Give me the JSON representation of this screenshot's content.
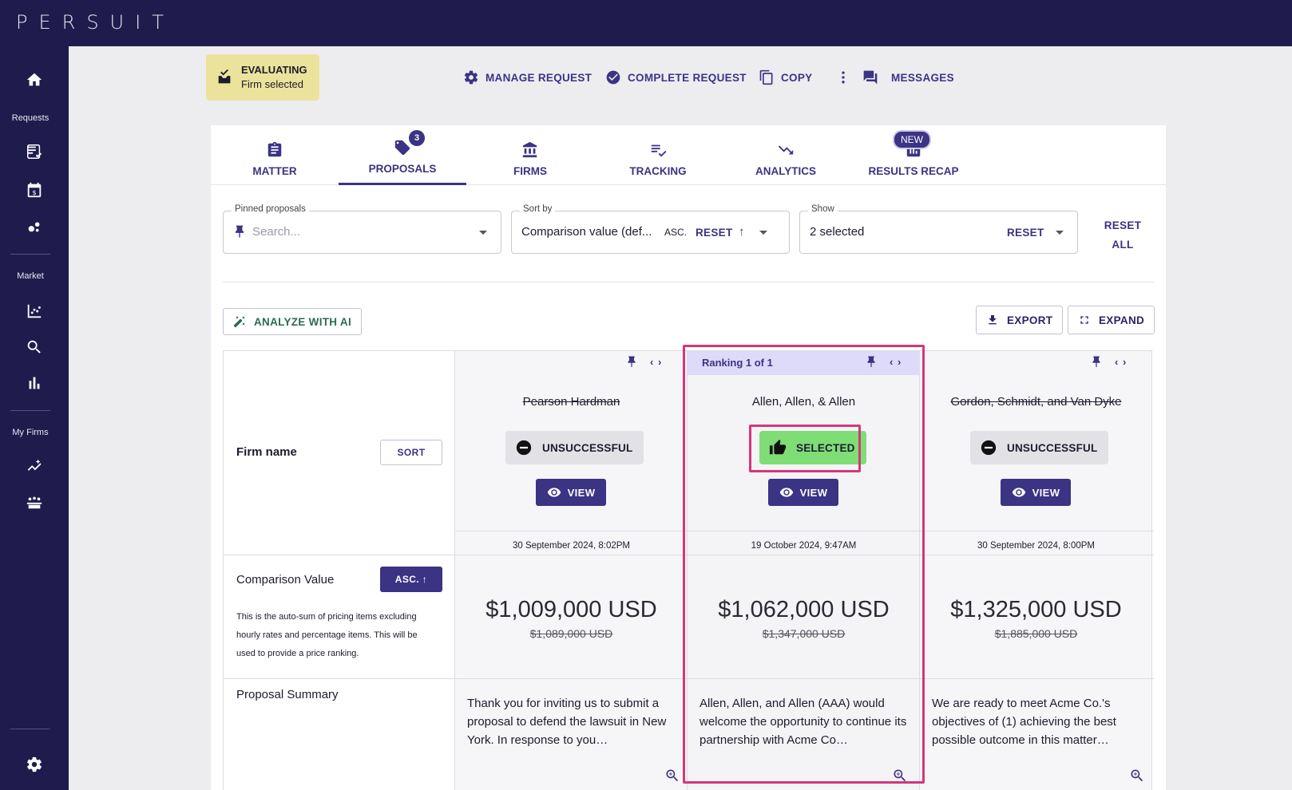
{
  "app": {
    "logo": "PERSUIT"
  },
  "rail": {
    "sections": [
      "Requests",
      "Market",
      "My Firms"
    ]
  },
  "status": {
    "title": "EVALUATING",
    "subtitle": "Firm selected"
  },
  "actions": {
    "manage": "MANAGE REQUEST",
    "complete": "COMPLETE REQUEST",
    "copy": "COPY",
    "messages": "MESSAGES"
  },
  "tabs": [
    {
      "label": "MATTER"
    },
    {
      "label": "PROPOSALS",
      "count": "3"
    },
    {
      "label": "FIRMS"
    },
    {
      "label": "TRACKING"
    },
    {
      "label": "ANALYTICS"
    },
    {
      "label": "RESULTS RECAP",
      "badge": "NEW"
    }
  ],
  "filters": {
    "pinned": {
      "label": "Pinned proposals",
      "placeholder": "Search..."
    },
    "sort": {
      "label": "Sort by",
      "value": "Comparison value (def...",
      "order": "ASC.",
      "reset": "RESET"
    },
    "show": {
      "label": "Show",
      "value": "2 selected",
      "reset": "RESET"
    },
    "reset_all_1": "RESET",
    "reset_all_2": "ALL"
  },
  "toolbar": {
    "analyze": "ANALYZE WITH AI",
    "export": "EXPORT",
    "expand": "EXPAND"
  },
  "rows": {
    "firm_name": "Firm name",
    "sort_btn": "SORT",
    "comparison": "Comparison Value",
    "asc_btn": "ASC. ↑",
    "comparison_desc": "This is the auto-sum of pricing items excluding hourly rates and percentage items. This will be used to provide a price ranking.",
    "summary": "Proposal Summary"
  },
  "proposals": [
    {
      "firm": "Pearson Hardman",
      "status": "UNSUCCESSFUL",
      "view": "VIEW",
      "date": "30 September 2024, 8:02PM",
      "price": "$1,009,000 USD",
      "old_price": "$1,089,000 USD",
      "summary": "Thank you for inviting us to submit a proposal to defend the lawsuit in New York. In response to you…"
    },
    {
      "rank": "Ranking 1 of 1",
      "firm": "Allen, Allen, & Allen",
      "status": "SELECTED",
      "view": "VIEW",
      "date": "19 October 2024, 9:47AM",
      "price": "$1,062,000 USD",
      "old_price": "$1,347,000 USD",
      "summary": "Allen, Allen, and Allen (AAA) would welcome the opportunity to continue its partnership with Acme Co…"
    },
    {
      "firm": "Gordon, Schmidt, and Van Dyke",
      "status": "UNSUCCESSFUL",
      "view": "VIEW",
      "date": "30 September 2024, 8:00PM",
      "price": "$1,325,000 USD",
      "old_price": "$1,885,000 USD",
      "summary": "We are ready to meet Acme Co.'s objectives of (1) achieving the best possible outcome in this matter…"
    }
  ],
  "colors": {
    "brand": "#201b4d",
    "accent": "#3b3384",
    "selected": "#7fdd76",
    "highlight": "#d6367c",
    "status_bg": "#ebe39b"
  }
}
